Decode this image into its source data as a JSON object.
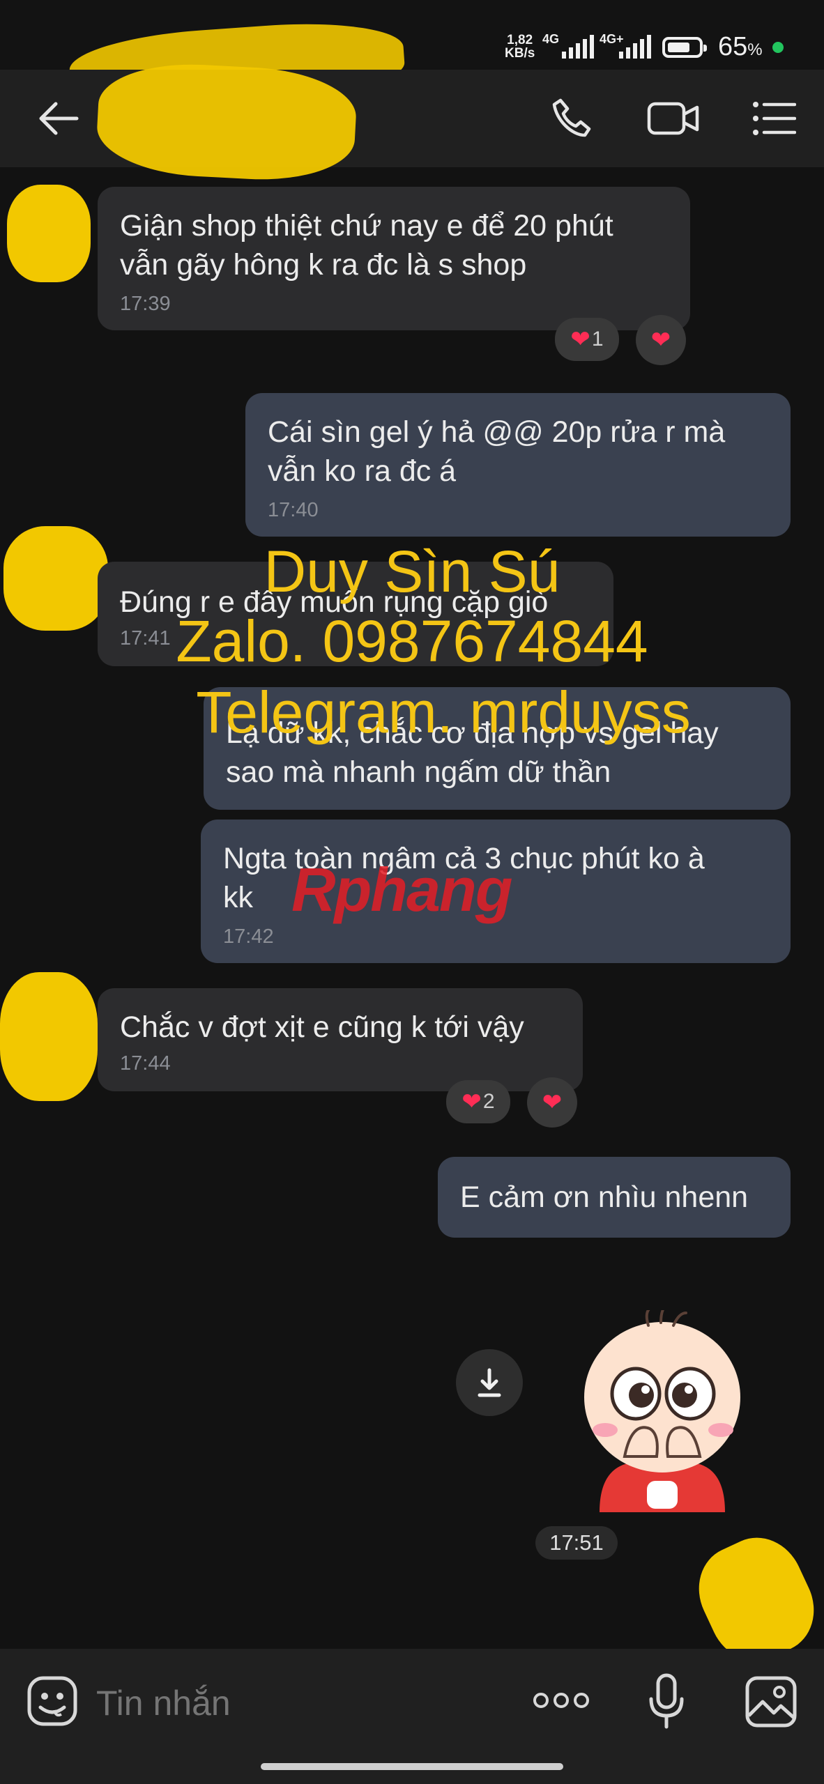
{
  "status_bar": {
    "speed_value": "1,82",
    "speed_unit": "KB/s",
    "net1": "4G",
    "net2": "4G+",
    "battery_pct": "65",
    "battery_pct_unit": "%",
    "battery_level": 0.65
  },
  "header": {
    "icons": [
      "back-arrow-icon",
      "phone-icon",
      "video-call-icon",
      "menu-icon"
    ]
  },
  "messages": [
    {
      "from": "other",
      "text_line1": "Giận shop thiệt chứ nay e để 20 phút",
      "text_line2": "vẫn gãy hông k ra đc là s shop",
      "time": "17:39",
      "reaction_count": "1"
    },
    {
      "from": "me",
      "text_line1": "Cái sìn gel ý hả @@ 20p rửa r mà",
      "text_line2": "vẫn ko ra đc á",
      "time": "17:40"
    },
    {
      "from": "other",
      "text_line1": "Đúng r e đẩy muốn rụng cặp giò",
      "time": "17:41"
    },
    {
      "from": "me",
      "text_line1": "Lạ dữ kk, chắc cơ địa hợp vs gel hay",
      "text_line2": "sao mà nhanh ngấm dữ thần"
    },
    {
      "from": "me",
      "text_line1": "Ngta toàn ngâm cả 3 chục phút ko à",
      "text_line2": "kk",
      "time": "17:42"
    },
    {
      "from": "other",
      "text_line1": "Chắc v đợt xịt e cũng k tới vậy",
      "time": "17:44",
      "reaction_count": "2"
    },
    {
      "from": "me",
      "text_line1": "E cảm ơn nhìu nhenn"
    }
  ],
  "sticker_time": "17:51",
  "watermark": {
    "line1": "Duy Sìn Sú",
    "line2": "Zalo. 0987674844",
    "line3": "Telegram. mrduyss",
    "logo_text": "Rphang"
  },
  "input": {
    "placeholder": "Tin nhắn",
    "icons": [
      "sticker-icon",
      "more-icon",
      "microphone-icon",
      "image-icon"
    ]
  },
  "colors": {
    "background": "#121212",
    "incoming_bubble": "#2c2c2e",
    "outgoing_bubble": "#3a4150",
    "watermark": "#f4c515",
    "heart": "#ff2d55"
  }
}
